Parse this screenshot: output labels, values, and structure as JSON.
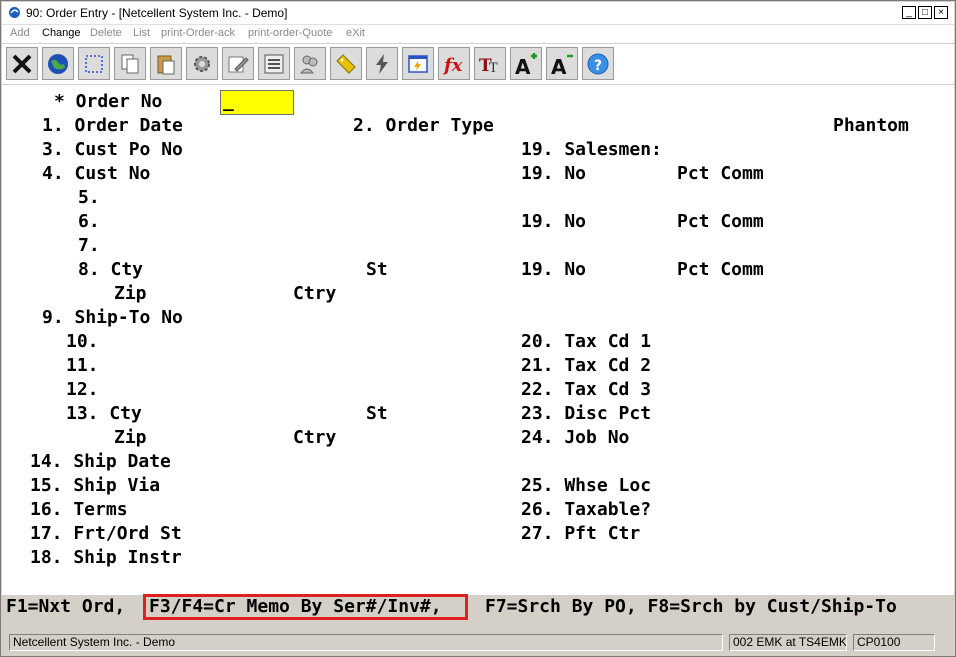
{
  "window": {
    "title": "90: Order Entry - [Netcellent System Inc. - Demo]",
    "controls": [
      "_",
      "□",
      "×"
    ]
  },
  "menu": [
    {
      "label": "Add",
      "enabled": false
    },
    {
      "label": "Change",
      "enabled": true
    },
    {
      "label": "Delete",
      "enabled": false
    },
    {
      "label": "List",
      "enabled": false
    },
    {
      "label": "print-Order-ack",
      "enabled": false
    },
    {
      "label": "print-order-Quote",
      "enabled": false
    },
    {
      "label": "eXit",
      "enabled": false
    }
  ],
  "toolbar": [
    {
      "name": "exit-icon"
    },
    {
      "name": "globe-icon"
    },
    {
      "name": "select-icon"
    },
    {
      "name": "copy-icon"
    },
    {
      "name": "paste-icon"
    },
    {
      "name": "settings-icon"
    },
    {
      "name": "edit-icon"
    },
    {
      "name": "list-icon"
    },
    {
      "name": "users-icon"
    },
    {
      "name": "tag-icon"
    },
    {
      "name": "lightning-icon"
    },
    {
      "name": "screen-icon"
    },
    {
      "name": "function-icon"
    },
    {
      "name": "font-icon"
    },
    {
      "name": "font-larger-icon"
    },
    {
      "name": "font-smaller-icon"
    },
    {
      "name": "help-icon"
    }
  ],
  "form": {
    "order_no_label": "* Order No",
    "order_no_value": "_",
    "f1": "1. Order Date",
    "f2": "2. Order Type",
    "order_type_value": "Phantom",
    "f3": "3. Cust Po No",
    "f4": "4. Cust No",
    "f5": "5.",
    "f6": "6.",
    "f7": "7.",
    "f8": "8. Cty",
    "f8_st": "St",
    "f8_zip": "Zip",
    "f8_ctry": "Ctry",
    "f9": "9. Ship-To No",
    "f10": "10.",
    "f11": "11.",
    "f12": "12.",
    "f13": "13. Cty",
    "f13_st": "St",
    "f13_zip": "Zip",
    "f13_ctry": "Ctry",
    "f14": "14. Ship Date",
    "f15": "15. Ship Via",
    "f16": "16. Terms",
    "f17": "17. Frt/Ord St",
    "f18": "18. Ship Instr",
    "f19_header": "19. Salesmen:",
    "f19_row1_no": "19. No",
    "f19_row1_pct": "Pct Comm",
    "f19_row2_no": "19. No",
    "f19_row2_pct": "Pct Comm",
    "f19_row3_no": "19. No",
    "f19_row3_pct": "Pct Comm",
    "f20": "20. Tax Cd 1",
    "f21": "21. Tax Cd 2",
    "f22": "22. Tax Cd 3",
    "f23": "23. Disc Pct",
    "f24": "24. Job No",
    "f25": "25. Whse Loc",
    "f26": "26. Taxable?",
    "f27": "27. Pft Ctr"
  },
  "fkeys": {
    "f1": "F1=Nxt Ord,",
    "f3f4": "F3/F4=Cr Memo By Ser#/Inv#,",
    "f7f8": "F7=Srch By PO, F8=Srch by Cust/Ship-To"
  },
  "status": {
    "company": "Netcellent System Inc. - Demo",
    "user": "002 EMK at TS4EMK",
    "program": "CP0100"
  },
  "colors": {
    "order_no_field": "#ffff00",
    "highlight_border": "#e02020"
  }
}
